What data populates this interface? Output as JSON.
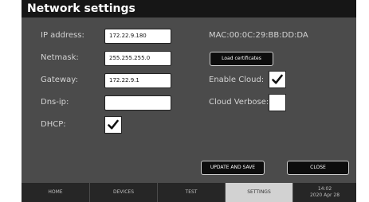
{
  "window": {
    "title": "Network settings"
  },
  "form": {
    "ip": {
      "label": "IP address:",
      "value": "172.22.9.180"
    },
    "netmask": {
      "label": "Netmask:",
      "value": "255.255.255.0"
    },
    "gateway": {
      "label": "Gateway:",
      "value": "172.22.9.1"
    },
    "dns": {
      "label": "Dns-ip:",
      "value": ""
    },
    "dhcp": {
      "label": "DHCP:",
      "checked": true
    }
  },
  "right": {
    "mac": "MAC:00:0C:29:BB:DD:DA",
    "load_certificates_label": "Load certificates",
    "enable_cloud": {
      "label": "Enable Cloud:",
      "checked": true
    },
    "cloud_verbose": {
      "label": "Cloud Verbose:",
      "checked": false
    }
  },
  "actions": {
    "update_label": "UPDATE AND SAVE",
    "close_label": "CLOSE"
  },
  "nav": {
    "tabs": [
      {
        "label": "HOME",
        "active": false
      },
      {
        "label": "DEVICES",
        "active": false
      },
      {
        "label": "TEST",
        "active": false
      },
      {
        "label": "SETTINGS",
        "active": true
      }
    ],
    "time": "14:02",
    "date": "2020 Apr 28"
  },
  "icons": {
    "check": "checkmark-icon"
  }
}
